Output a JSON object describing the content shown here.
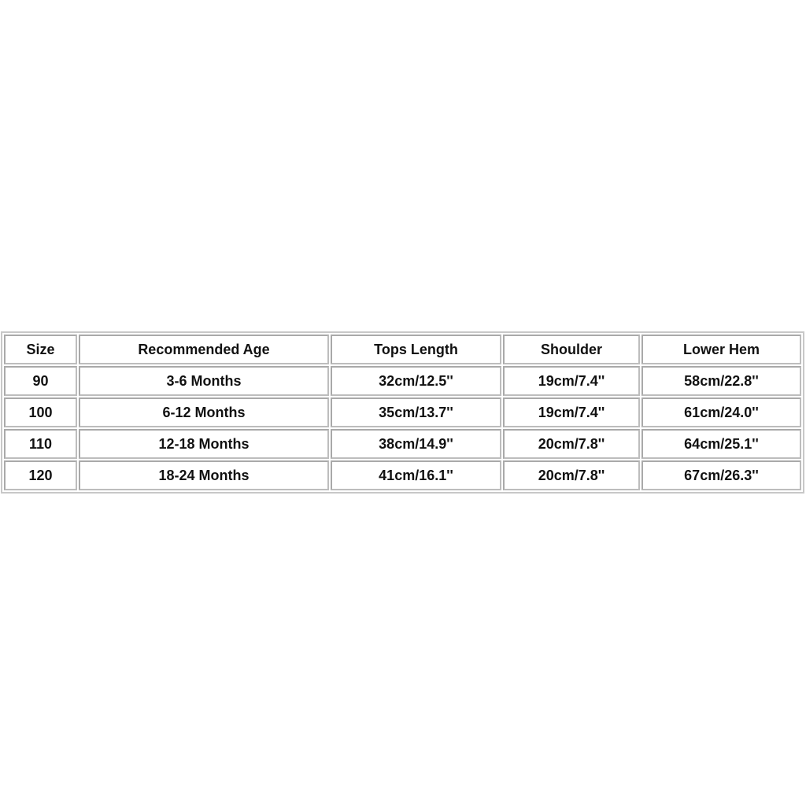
{
  "table": {
    "headers": [
      "Size",
      "Recommended Age",
      "Tops Length",
      "Shoulder",
      "Lower Hem"
    ],
    "rows": [
      [
        "90",
        "3-6 Months",
        "32cm/12.5''",
        "19cm/7.4''",
        "58cm/22.8''"
      ],
      [
        "100",
        "6-12 Months",
        "35cm/13.7''",
        "19cm/7.4''",
        "61cm/24.0''"
      ],
      [
        "110",
        "12-18 Months",
        "38cm/14.9''",
        "20cm/7.8''",
        "64cm/25.1''"
      ],
      [
        "120",
        "18-24 Months",
        "41cm/16.1''",
        "20cm/7.8''",
        "67cm/26.3''"
      ]
    ]
  }
}
